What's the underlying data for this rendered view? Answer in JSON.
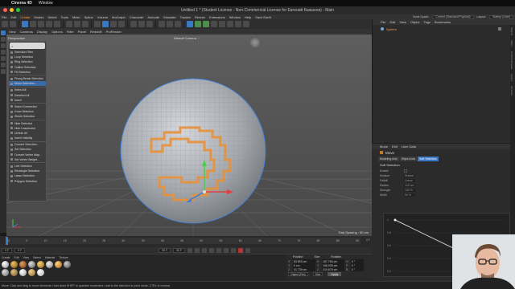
{
  "mac_menu": {
    "app": "Cinema 4D",
    "window_menu": "Window"
  },
  "window": {
    "title": "Untitled 1 * (Student License - Non-Commercial License for Евгений Бажанов) - Main"
  },
  "main_menu": [
    "File",
    "Edit",
    "Create",
    "Modes",
    "Select",
    "Tools",
    "Mesh",
    "Spline",
    "Volume",
    "MoGraph",
    "Character",
    "Animate",
    "Simulate",
    "Tracker",
    "Render",
    "Extensions",
    "Window",
    "Help",
    "Save Earth"
  ],
  "menu_right": {
    "node_space_label": "Node Space:",
    "node_space_value": "Current (Standard/Physical)",
    "layout_label": "Layout:",
    "layout_value": "Startup (User)"
  },
  "viewport": {
    "menu": [
      "View",
      "Cameras",
      "Display",
      "Options",
      "Filter",
      "Panel",
      "Redshift",
      "ProRender"
    ],
    "perspective_label": "Perspective",
    "camera_label": "Default Camera ⁘",
    "grid_spacing": "Grid Spacing : 50 cm"
  },
  "context_menu": {
    "search_placeholder": "",
    "items": [
      "Selection Filter",
      "Loop Selection",
      "Ring Selection",
      "Outline Selection",
      "Fill Selection",
      "Phong Break Selection",
      "Mirror Selection...",
      "Select All",
      "Deselect All",
      "Invert",
      "Select Connected",
      "Grow Selection",
      "Shrink Selection",
      "Hide Selected",
      "Hide Unselected",
      "Unhide All",
      "Invert Visibility",
      "Convert Selection...",
      "Set Selection",
      "Convert Vertex Map...",
      "Set Vertex Weight...",
      "Live Selection",
      "Rectangle Selection",
      "Lasso Selection",
      "Polygon Selection"
    ]
  },
  "timeline": {
    "ticks": [
      "0",
      "5",
      "10",
      "15",
      "20",
      "25",
      "30",
      "35",
      "40",
      "45",
      "50",
      "55",
      "60",
      "65",
      "70",
      "75",
      "80",
      "85",
      "90"
    ],
    "end_label": "0 F"
  },
  "transport": {
    "start": "0 F",
    "current": "0 F",
    "end_a": "90 F",
    "end_b": "90 F"
  },
  "materials": {
    "menu": [
      "Create",
      "Edit",
      "View",
      "Select",
      "Material",
      "Texture"
    ]
  },
  "coordinates": {
    "headers": [
      "Position",
      "Size",
      "Rotation"
    ],
    "rows": [
      {
        "axis": "X",
        "pos": "83.893 cm",
        "size_axis": "X",
        "size": "187.784 cm",
        "rot_axis": "H",
        "rot": "0 °"
      },
      {
        "axis": "Y",
        "pos": "0 cm",
        "size_axis": "Y",
        "size": "166.935 cm",
        "rot_axis": "P",
        "rot": "0 °"
      },
      {
        "axis": "Z",
        "pos": "41.739 cm",
        "size_axis": "Z",
        "size": "210.678 cm",
        "rot_axis": "B",
        "rot": "0 °"
      }
    ],
    "mode": "Object (Rel)",
    "size_mode": "Size",
    "apply": "Apply"
  },
  "status": "Move: Click and drag to move elements. Hold down SHIFT to quantize movement / add to the selection in point mode, CTRL to remove.",
  "object_manager": {
    "menu": [
      "File",
      "Edit",
      "View",
      "Object",
      "Tags",
      "Bookmarks"
    ],
    "objects": [
      {
        "name": "Sphere"
      }
    ]
  },
  "side_tabs": [
    "Objects",
    "Takes",
    "Content Browser",
    "Layers",
    "Structure"
  ],
  "attributes": {
    "menu": [
      "Mode",
      "Edit",
      "User Data"
    ],
    "tool": "Move",
    "tabs": [
      "Modeling Axis",
      "Object Axis",
      "Soft Selection"
    ],
    "active_tab": "Soft Selection",
    "section": "Soft Selection",
    "rows": [
      {
        "label": "Enable",
        "value": ""
      },
      {
        "label": "Surface",
        "value": "Rubber"
      },
      {
        "label": "Falloff",
        "value": "Linear"
      },
      {
        "label": "Radius",
        "value": "100 cm"
      },
      {
        "label": "Strength",
        "value": "100 %"
      },
      {
        "label": "Width",
        "value": "50 %"
      }
    ],
    "preview_label": "Preview",
    "curve_ticks": [
      "1",
      "0.8",
      "0.6",
      "0.4",
      "0.2"
    ]
  }
}
